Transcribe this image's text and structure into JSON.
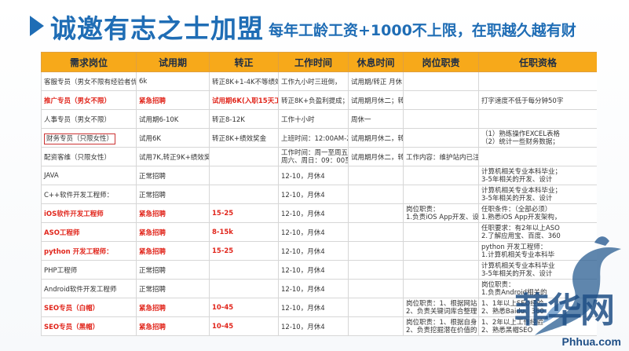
{
  "header": {
    "title": "诚邀有志之士加盟",
    "subtitle": "每年工龄工资+1000不上限，在职越久越有财"
  },
  "table": {
    "columns": [
      "需求岗位",
      "试用期",
      "转正",
      "工作时间",
      "休息时间",
      "岗位职责",
      "任职资格"
    ],
    "rows": [
      [
        "客服专员（男女不限有经验者优",
        "6k",
        "转正8K+1-4K不等绩效",
        "工作九小时三班倒，",
        "试用期/转正 月休",
        "",
        ""
      ],
      [
        "推广专员（男女不限）",
        "紧急招聘",
        "试用期6K(入职15天工",
        "转正8K+负盈利提成；",
        "试用期月休二；转",
        "",
        "打字速度不低于每分钟50字"
      ],
      [
        "人事专员（男女不限）",
        "试用期6-10K",
        "转正8-12K",
        "工作十小时",
        "周休一",
        "",
        ""
      ],
      [
        "财务专员（只限女性）",
        "试用6K",
        "转正8K+绩效奖金",
        "上班时间：12:00AM-2",
        "试用期月休二，转",
        "",
        "（1）熟练操作EXCEL表格\n（2）统计一些财务数据；"
      ],
      [
        "配资客维（只限女性）",
        "试用7K,转正9K+绩效奖",
        "",
        "工作时间：周一至周五\n周六、周日：09：00至",
        "试用期月休二，转",
        "工作内容：维护站内已注",
        ""
      ],
      [
        "JAVA",
        "正常招聘",
        "",
        "12-10，月休4",
        "",
        "",
        "计算机相关专业本科毕业；\n3-5年相关的开发、设计"
      ],
      [
        "C++软件开发工程师：",
        "正常招聘",
        "",
        "12-10，月休4",
        "",
        "",
        "计算机相关专业本科毕业；\n3-5年相关的开发、设计"
      ],
      [
        "iOS软件开发工程师",
        "紧急招聘",
        "15-25",
        "12-10，月休4",
        "",
        "岗位职责：\n1.负责iOS App开发、设计",
        "任职条件：（全部必须）\n1.熟悉iOS App开发架构，"
      ],
      [
        "ASO工程师",
        "紧急招聘",
        "8-15k",
        "12-10，月休4",
        "",
        "",
        "任职要求：有2年以上ASO\n2.了解应用宝、百度、360"
      ],
      [
        "python 开发工程师：",
        "紧急招聘",
        "15-25",
        "12-10，月休4",
        "",
        "",
        "python 开发工程师：\n1.计算机相关专业本科毕"
      ],
      [
        "PHP工程师",
        "正常招聘",
        "",
        "12-10，月休4",
        "",
        "",
        "计算机相关专业本科毕业\n3-5年相关的开发、设计"
      ],
      [
        "Android软件开发工程师",
        "正常招聘",
        "",
        "12-10，月休4",
        "",
        "",
        "岗位职责：\n1.负责Android相关的"
      ],
      [
        "SEO专员（白帽）",
        "紧急招聘",
        "10-45",
        "12-10，月休4",
        "",
        "岗位职责：1、根据网站\n2、负责关键词库合整理",
        "1、1年以上SEO经验\n2、熟悉Baidu、360"
      ],
      [
        "SEO专员（黑帽）",
        "紧急招聘",
        "10-45",
        "12-10，月休4",
        "",
        "岗位职责：1、根据自身\n2、负责挖掘潜在价值的",
        "1、2年以上工作经验\n2、熟悉黑帽SEO"
      ]
    ]
  },
  "watermark": {
    "brand_cn": "菲华网",
    "brand_url": "Phhua.com"
  },
  "colors": {
    "accent_blue": "#1f6db5",
    "header_orange": "#f7a91a",
    "urgent_red": "#e1261c"
  }
}
